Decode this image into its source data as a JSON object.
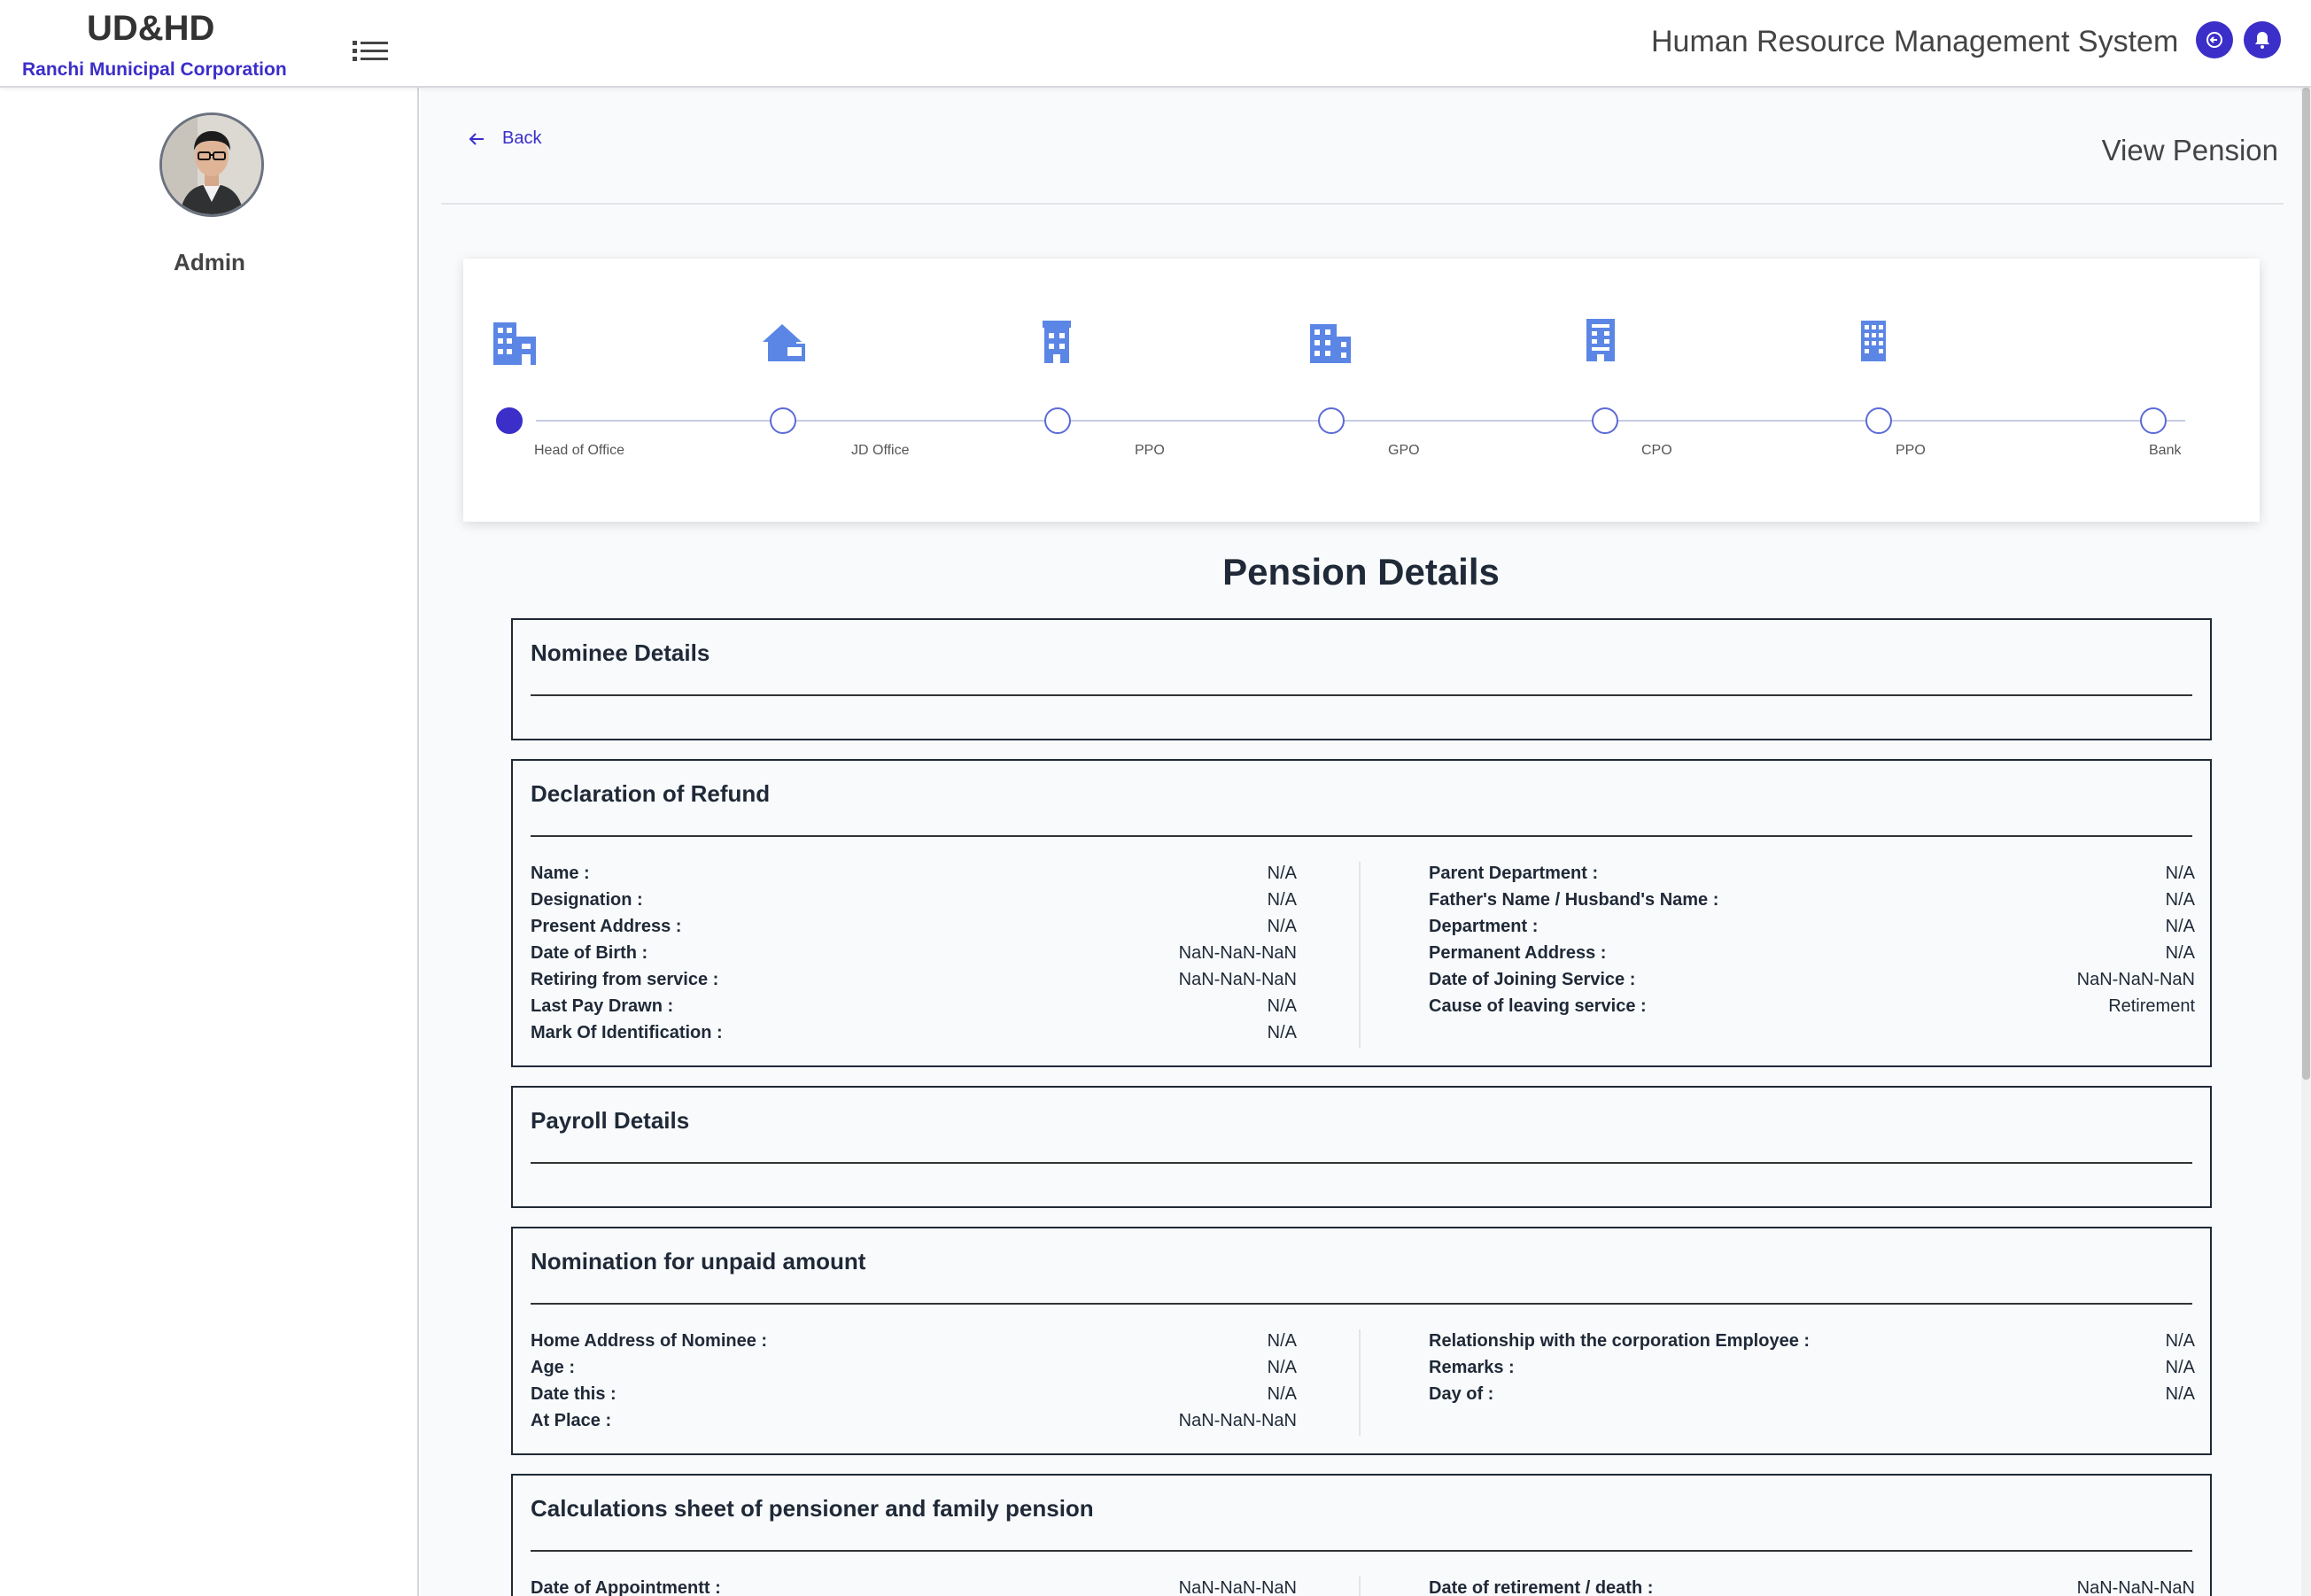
{
  "header": {
    "brand_title": "UD&HD",
    "brand_subtitle": "Ranchi Municipal Corporation",
    "app_title": "Human Resource Management System",
    "menu_icon": "list-icon",
    "logout_icon": "logout-icon",
    "bell_icon": "bell-icon"
  },
  "sidebar": {
    "user_name": "Admin"
  },
  "main": {
    "back_label": "Back",
    "page_heading": "View Pension"
  },
  "progress": {
    "steps": [
      {
        "label": "Head of Office",
        "icon": "office-building-icon",
        "active": true
      },
      {
        "label": "JD Office",
        "icon": "house-icon",
        "active": false
      },
      {
        "label": "PPO",
        "icon": "building-icon",
        "active": false
      },
      {
        "label": "GPO",
        "icon": "apartment-icon",
        "active": false
      },
      {
        "label": "CPO",
        "icon": "tower-icon",
        "active": false
      },
      {
        "label": "PPO",
        "icon": "grid-building-icon",
        "active": false
      },
      {
        "label": "Bank",
        "icon": "",
        "active": false
      }
    ]
  },
  "section_title": "Pension Details",
  "nominee": {
    "title": "Nominee Details"
  },
  "declaration": {
    "title": "Declaration of Refund",
    "left": [
      {
        "k": "Name :",
        "v": "N/A"
      },
      {
        "k": "Designation :",
        "v": "N/A"
      },
      {
        "k": "Present Address :",
        "v": "N/A"
      },
      {
        "k": "Date of Birth :",
        "v": "NaN-NaN-NaN"
      },
      {
        "k": "Retiring from service :",
        "v": "NaN-NaN-NaN"
      },
      {
        "k": "Last Pay Drawn :",
        "v": "N/A"
      },
      {
        "k": "Mark Of Identification :",
        "v": "N/A"
      }
    ],
    "right": [
      {
        "k": "Parent Department :",
        "v": "N/A"
      },
      {
        "k": "Father's Name / Husband's Name :",
        "v": "N/A"
      },
      {
        "k": "Department :",
        "v": "N/A"
      },
      {
        "k": "Permanent Address :",
        "v": "N/A"
      },
      {
        "k": "Date of Joining Service :",
        "v": "NaN-NaN-NaN"
      },
      {
        "k": "Cause of leaving service :",
        "v": "Retirement"
      }
    ]
  },
  "payroll": {
    "title": "Payroll Details"
  },
  "nomination": {
    "title": "Nomination for unpaid amount",
    "left": [
      {
        "k": "Home Address of Nominee :",
        "v": "N/A"
      },
      {
        "k": "Age :",
        "v": "N/A"
      },
      {
        "k": "Date this :",
        "v": "N/A"
      },
      {
        "k": "At Place :",
        "v": "NaN-NaN-NaN"
      }
    ],
    "right": [
      {
        "k": "Relationship with the corporation Employee :",
        "v": "N/A"
      },
      {
        "k": "Remarks :",
        "v": "N/A"
      },
      {
        "k": "Day of :",
        "v": "N/A"
      }
    ]
  },
  "calculations": {
    "title": "Calculations sheet of pensioner and family pension",
    "left": [
      {
        "k": "Date of Appointmentt :",
        "v": "NaN-NaN-NaN"
      }
    ],
    "right": [
      {
        "k": "Date of retirement / death :",
        "v": "NaN-NaN-NaN"
      }
    ]
  },
  "colors": {
    "accent": "#3b2ec9",
    "step_icon": "#5b86e5"
  }
}
